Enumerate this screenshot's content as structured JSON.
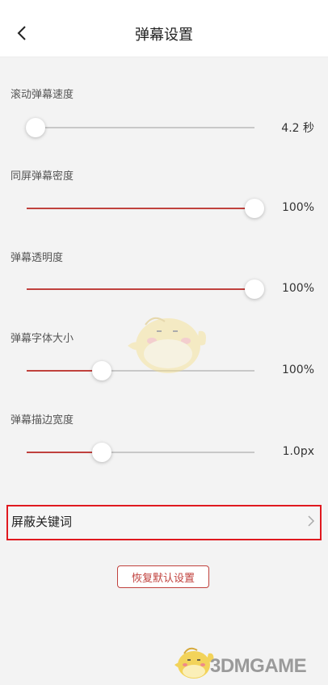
{
  "header": {
    "title": "弹幕设置"
  },
  "settings": [
    {
      "label": "滚动弹幕速度",
      "value": "4.2 秒",
      "level": 0.04
    },
    {
      "label": "同屏弹幕密度",
      "value": "100%",
      "level": 1.0
    },
    {
      "label": "弹幕透明度",
      "value": "100%",
      "level": 1.0
    },
    {
      "label": "弹幕字体大小",
      "value": "100%",
      "level": 0.33
    },
    {
      "label": "弹幕描边宽度",
      "value": "1.0px",
      "level": 0.33
    }
  ],
  "keywords": {
    "label": "屏蔽关键词"
  },
  "reset": {
    "label": "恢复默认设置"
  },
  "watermark": {
    "text": "3DMGAME"
  },
  "colors": {
    "accent": "#c0413d",
    "highlight": "#e0191f",
    "track": "#c8c8c8"
  },
  "icons": {
    "back": "chevron-left-icon",
    "more": "chevron-right-icon"
  }
}
